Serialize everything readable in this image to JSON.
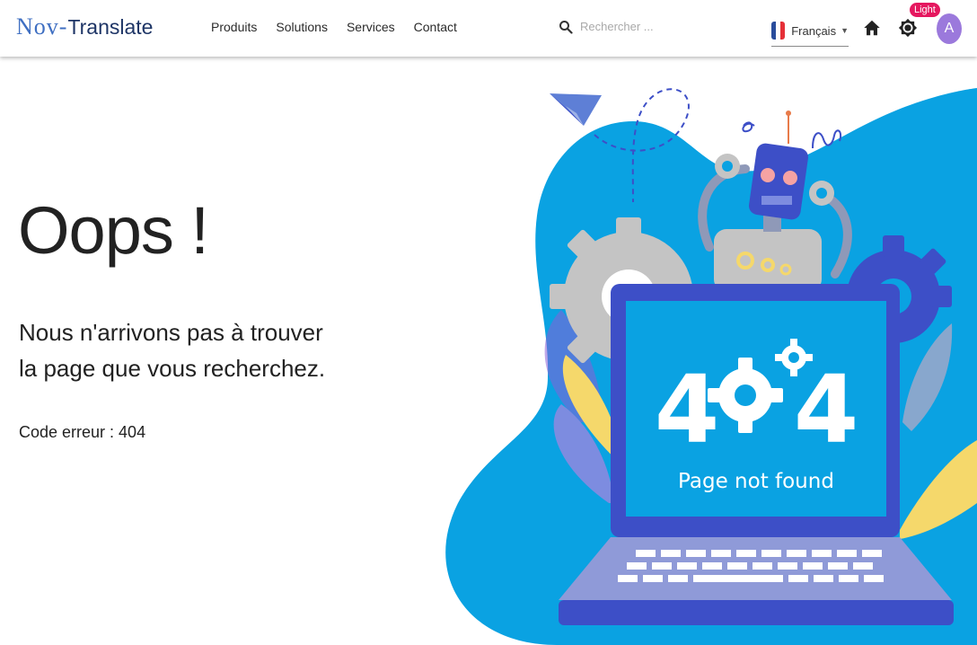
{
  "header": {
    "logo_part1": "Nov-",
    "logo_part2": "Translate",
    "nav": [
      "Produits",
      "Solutions",
      "Services",
      "Contact"
    ],
    "search_placeholder": "Rechercher ...",
    "language": "Français",
    "theme_badge": "Light",
    "avatar_initial": "A"
  },
  "main": {
    "title": "Oops !",
    "message": "Nous n'arrivons pas à trouver la page que vous recherchez.",
    "error_code": "Code erreur : 404"
  },
  "illustration": {
    "big_text": "404",
    "caption": "Page not found"
  },
  "colors": {
    "brand_blue": "#3f6fc2",
    "blob_blue": "#0aa2e2",
    "laptop_indigo": "#3d4fc7",
    "badge_pink": "#e5175f",
    "avatar_purple": "#9b79dc"
  }
}
